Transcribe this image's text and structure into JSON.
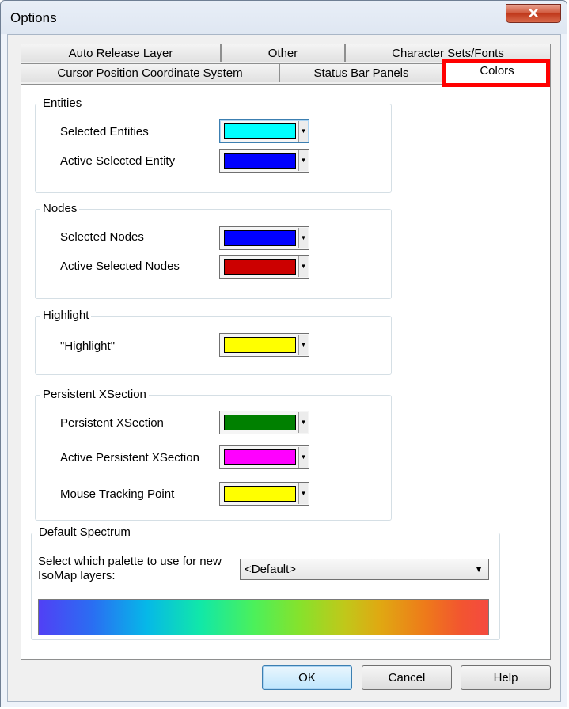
{
  "window": {
    "title": "Options",
    "close_glyph": "✕"
  },
  "tabs_row1": [
    {
      "label": "Auto Release Layer"
    },
    {
      "label": "Other"
    },
    {
      "label": "Character Sets/Fonts"
    }
  ],
  "tabs_row2": [
    {
      "label": "Cursor Position Coordinate System"
    },
    {
      "label": "Status Bar Panels"
    },
    {
      "label": "Colors",
      "selected": true
    }
  ],
  "groups": {
    "entities": {
      "title": "Entities",
      "rows": [
        {
          "label": "Selected Entities",
          "color": "#00ffff"
        },
        {
          "label": "Active Selected Entity",
          "color": "#0000ff"
        }
      ]
    },
    "nodes": {
      "title": "Nodes",
      "rows": [
        {
          "label": "Selected Nodes",
          "color": "#0000ff"
        },
        {
          "label": "Active Selected Nodes",
          "color": "#cc0000"
        }
      ]
    },
    "highlight": {
      "title": "Highlight",
      "rows": [
        {
          "label": "\"Highlight\"",
          "color": "#ffff00"
        }
      ]
    },
    "xsection": {
      "title": "Persistent XSection",
      "rows": [
        {
          "label": "Persistent XSection",
          "color": "#008000"
        },
        {
          "label": "Active Persistent XSection",
          "color": "#ff00ff"
        },
        {
          "label": "Mouse Tracking Point",
          "color": "#ffff00"
        }
      ]
    }
  },
  "spectrum": {
    "title": "Default Spectrum",
    "prompt": "Select which palette to use for new IsoMap layers:",
    "selected_palette": "<Default>"
  },
  "buttons": {
    "ok": "OK",
    "cancel": "Cancel",
    "help": "Help"
  }
}
